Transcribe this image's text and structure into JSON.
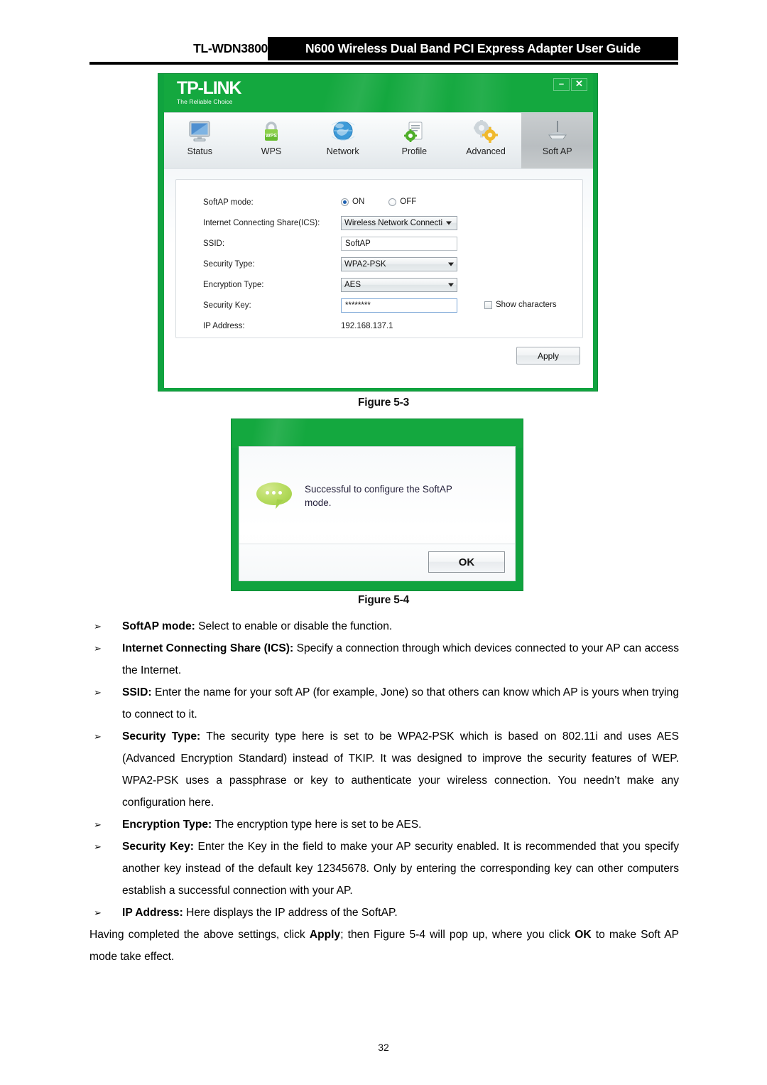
{
  "header": {
    "model": "TL-WDN3800",
    "title": "N600 Wireless Dual Band PCI Express Adapter User Guide"
  },
  "app_window": {
    "brand": "TP-LINK",
    "tagline": "The Reliable Choice",
    "window_controls": {
      "minimize": "–",
      "close": "✕"
    },
    "nav": [
      {
        "label": "Status",
        "icon": "monitor-icon",
        "active": false
      },
      {
        "label": "WPS",
        "icon": "wps-lock-icon",
        "active": false
      },
      {
        "label": "Network",
        "icon": "globe-icon",
        "active": false
      },
      {
        "label": "Profile",
        "icon": "profile-icon",
        "active": false
      },
      {
        "label": "Advanced",
        "icon": "gears-icon",
        "active": false
      },
      {
        "label": "Soft AP",
        "icon": "router-icon",
        "active": true
      }
    ],
    "form": {
      "softap_mode": {
        "label": "SoftAP mode:",
        "on_label": "ON",
        "off_label": "OFF",
        "selected": "ON"
      },
      "ics": {
        "label": "Internet Connecting Share(ICS):",
        "value": "Wireless Network Connecti"
      },
      "ssid": {
        "label": "SSID:",
        "value": "SoftAP"
      },
      "security_type": {
        "label": "Security Type:",
        "value": "WPA2-PSK"
      },
      "encryption_type": {
        "label": "Encryption Type:",
        "value": "AES"
      },
      "security_key": {
        "label": "Security Key:",
        "value": "********",
        "show_characters_label": "Show characters",
        "show_characters_checked": false
      },
      "ip_address": {
        "label": "IP Address:",
        "value": "192.168.137.1"
      }
    },
    "apply_label": "Apply"
  },
  "figure_3_caption": "Figure 5-3",
  "dialog": {
    "message": "Successful to configure the SoftAP mode.",
    "ok_label": "OK",
    "icon": "speech-bubble-icon"
  },
  "figure_4_caption": "Figure 5-4",
  "body": {
    "bullets": [
      {
        "term": "SoftAP mode:",
        "text": " Select to enable or disable the function."
      },
      {
        "term": "Internet Connecting Share (ICS):",
        "text": " Specify a connection through which devices connected to your AP can access the Internet."
      },
      {
        "term": "SSID:",
        "text": " Enter the name for your soft AP (for example, Jone) so that others can know which AP is yours when trying to connect to it."
      },
      {
        "term": "Security Type:",
        "text": " The security type here is set to be WPA2-PSK which is based on 802.11i and uses AES (Advanced Encryption Standard) instead of TKIP. It was designed to improve the security features of WEP. WPA2-PSK uses a passphrase or key to authenticate your wireless connection. You needn’t make any configuration here."
      },
      {
        "term": "Encryption Type:",
        "text": " The encryption type here is set to be AES."
      },
      {
        "term": "Security Key:",
        "text": " Enter the Key in the field to make your AP security enabled. It is recommended that you specify another key instead of the default key 12345678. Only by entering the corresponding key can other computers establish a successful connection with your AP."
      },
      {
        "term": "IP Address:",
        "text": " Here displays the IP address of the SoftAP."
      }
    ],
    "closing_paragraph": {
      "part1": "Having completed the above settings, click ",
      "bold1": "Apply",
      "part2": "; then Figure 5-4 will pop up, where you click ",
      "bold2": "OK",
      "part3": " to make Soft AP mode take effect."
    },
    "bullet_marker": "➢"
  },
  "page_number": "32",
  "colors": {
    "brand_green": "#10a33f",
    "header_bar": "#000000",
    "accent_blue": "#1c5fb0"
  }
}
